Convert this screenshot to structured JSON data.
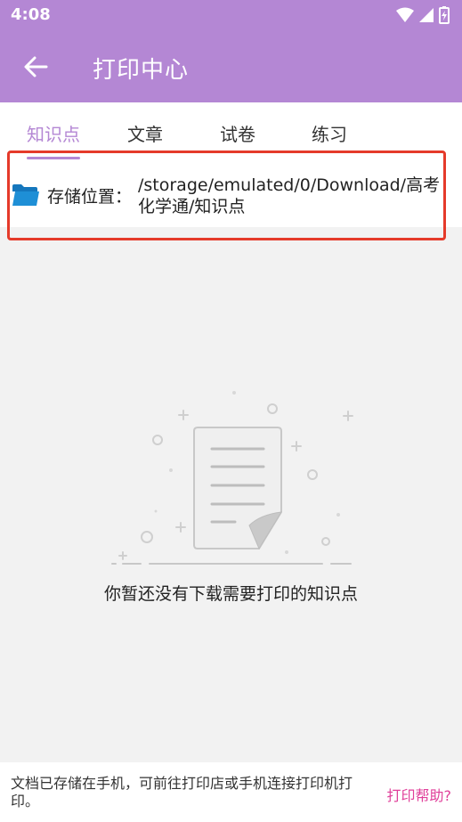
{
  "status_bar": {
    "time": "4:08"
  },
  "header": {
    "title": "打印中心"
  },
  "tabs": [
    {
      "label": "知识点"
    },
    {
      "label": "文章"
    },
    {
      "label": "试卷"
    },
    {
      "label": "练习"
    }
  ],
  "storage": {
    "label": "存储位置：",
    "path": "/storage/emulated/0/Download/高考化学通/知识点"
  },
  "empty_state": {
    "message": "你暂还没有下载需要打印的知识点"
  },
  "footer": {
    "info": "文档已存储在手机，可前往打印店或手机连接打印机打印。",
    "help": "打印帮助?"
  },
  "colors": {
    "accent": "#b487d4",
    "highlight": "#e53a2a",
    "help_link": "#e0409a",
    "folder": "#1e8fd6"
  }
}
